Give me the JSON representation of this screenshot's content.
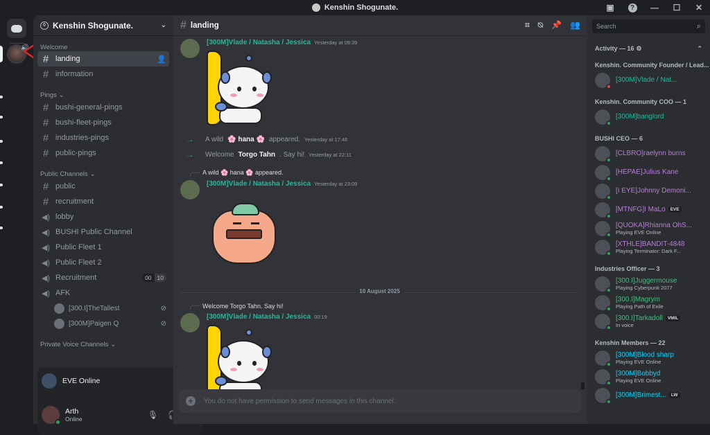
{
  "window": {
    "title": "Kenshin Shogunate.",
    "controls": [
      "inbox-icon",
      "help-icon",
      "minimize",
      "maximize",
      "close"
    ]
  },
  "server": {
    "name": "Kenshin Shogunate."
  },
  "sidebar": {
    "categories": {
      "welcome": "Welcome",
      "pings": "Pings",
      "public": "Public Channels",
      "private_voice": "Private Voice Channels"
    },
    "welcome_channels": [
      "landing",
      "information"
    ],
    "ping_channels": [
      "bushi-general-pings",
      "bushi-fleet-pings",
      "industries-pings",
      "public-pings"
    ],
    "public_text_channels": [
      "public",
      "recruitment"
    ],
    "voice_channels": [
      "lobby",
      "BUSHI Public Channel",
      "Public Fleet 1",
      "Public Fleet 2",
      "Recruitment",
      "AFK"
    ],
    "recruitment_counts": [
      "00",
      "10"
    ],
    "afk_users": [
      "[300.I]TheTallest",
      "[300M]Paigen Q"
    ]
  },
  "voice_panel": {
    "label": "EVE Online"
  },
  "user_panel": {
    "name": "Arth",
    "status": "Online"
  },
  "chat": {
    "channel": "landing",
    "messages": [
      {
        "author": "[300M]Vlade / Natasha / Jessica",
        "time": "Yesterday at 09:39"
      },
      {
        "author": "[300M]Vlade / Natasha / Jessica",
        "time": "Yesterday at 23:09"
      },
      {
        "author": "[300M]Vlade / Natasha / Jessica",
        "time": "00:19"
      }
    ],
    "system": [
      {
        "prefix": "A wild",
        "name": "🌸 hana 🌸",
        "suffix": "appeared.",
        "time": "Yesterday at 17:46"
      },
      {
        "prefix": "Welcome",
        "name": "Torgo Tahn",
        "suffix": ". Say hi!",
        "time": "Yesterday at 22:11"
      }
    ],
    "replies": [
      "A wild 🌸 hana 🌸 appeared.",
      "Welcome Torgo Tahn. Say hi!"
    ],
    "date_divider": "10 August 2025",
    "composer_placeholder": "You do not have permission to send messages in this channel."
  },
  "members": {
    "search_placeholder": "Search",
    "activity_label": "Activity — 16",
    "groups": [
      {
        "title": "Kenshin. Community Founder / Lead...",
        "members": [
          {
            "name": "[300M]Vlade / Nat...",
            "color": "#1abc9c",
            "status": "dnd",
            "activity": ""
          }
        ]
      },
      {
        "title": "Kenshin. Community COO — 1",
        "members": [
          {
            "name": "[300M]banglord",
            "color": "#1abc9c",
            "status": "online",
            "activity": ""
          }
        ]
      },
      {
        "title": "BUSHI CEO — 6",
        "members": [
          {
            "name": "[CLBRO]raelynn burns",
            "color": "#b77fd6",
            "status": "online",
            "activity": ""
          },
          {
            "name": "[HEPAE]Julius Kane",
            "color": "#b77fd6",
            "status": "online",
            "activity": ""
          },
          {
            "name": "[I EYE]Johnny Demoni...",
            "color": "#b77fd6",
            "status": "online",
            "activity": ""
          },
          {
            "name": "[MTNFG]I MaLo",
            "color": "#b77fd6",
            "status": "online",
            "activity": "",
            "tag": "EVE"
          },
          {
            "name": "[QUOKA]Rhianna OhS...",
            "color": "#b77fd6",
            "status": "online",
            "activity": "Playing EVE Online"
          },
          {
            "name": "[XTHLE]BANDIT-4848",
            "color": "#b77fd6",
            "status": "online",
            "activity": "Playing Terminator: Dark F..."
          }
        ]
      },
      {
        "title": "Industries Officer — 3",
        "members": [
          {
            "name": "[300.I]Juggermouse",
            "color": "#3fbf7f",
            "status": "online",
            "activity": "Playing Cyberpunk 2077"
          },
          {
            "name": "[300.I]Magrym",
            "color": "#3fbf7f",
            "status": "online",
            "activity": "Playing Path of Exile"
          },
          {
            "name": "[300.I]Tarkadoll",
            "color": "#3fbf7f",
            "status": "online",
            "activity": "In voice",
            "tag": "VMIL"
          }
        ]
      },
      {
        "title": "Kenshin Members — 22",
        "members": [
          {
            "name": "[300M]Blood sharp",
            "color": "#00d5ff",
            "status": "online",
            "activity": "Playing EVE Online"
          },
          {
            "name": "[300M]Bobbyd",
            "color": "#00d5ff",
            "status": "online",
            "activity": "Playing EVE Online"
          },
          {
            "name": "[300M]Brimest...",
            "color": "#00d5ff",
            "status": "online",
            "activity": "",
            "tag": "LW"
          }
        ]
      }
    ]
  }
}
